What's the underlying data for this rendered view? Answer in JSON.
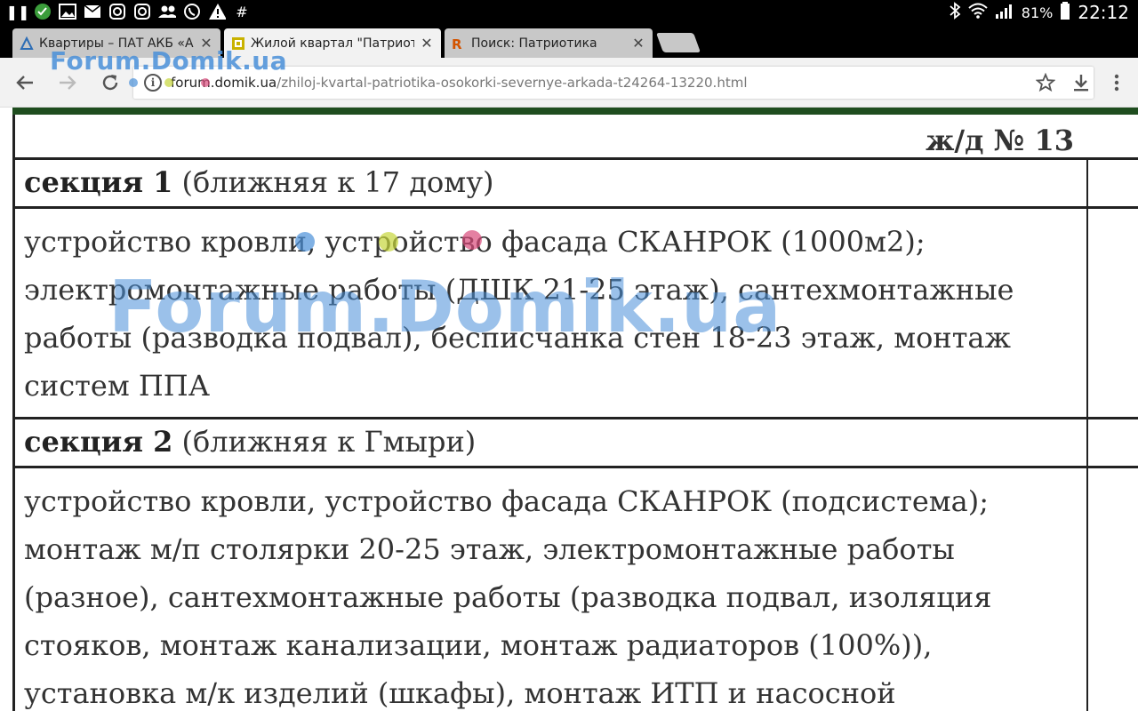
{
  "status": {
    "battery": "81%",
    "time": "22:12"
  },
  "tabs": [
    {
      "title": "Квартиры – ПАТ АКБ «АРКАДА»",
      "active": false
    },
    {
      "title": "Жилой квартал \"Патриотика\"",
      "active": true
    },
    {
      "title": "Поиск: Патриотика",
      "active": false
    }
  ],
  "toolbar": {
    "url_host": "forum.domik.ua",
    "url_path": "/zhiloj-kvartal-patriotika-osokorki-severnye-arkada-t24264-13220.html"
  },
  "watermark": {
    "small": "Forum.Domik.ua",
    "big": "Forum.Domik.ua"
  },
  "document": {
    "header": "ж/д № 13",
    "section1_label": "секция 1",
    "section1_note": " (ближняя к 17 дому)",
    "section1_text": "устройство кровли, устройство фасада СКАНРОК (1000м2); электромонтажные работы (ДШК 21-25 этаж), сантехмонтажные работы (разводка подвал), бесписчанка стен 18-23 этаж, монтаж систем ППА",
    "section2_label": "секция 2",
    "section2_note": " (ближняя к Гмыри)",
    "section2_text": " устройство кровли, устройство фасада СКАНРОК (подсистема); монтаж м/п столярки 20-25 этаж, электромонтажные работы (разное), сантехмонтажные работы (разводка подвал, изоляция стояков, монтаж канализации, монтаж радиаторов (100%)), установка м/к изделий (шкафы), монтаж ИТП и насосной"
  },
  "colors": {
    "accent": "#4a90d9",
    "border": "#222222",
    "greenbar": "#1f4d1f"
  }
}
